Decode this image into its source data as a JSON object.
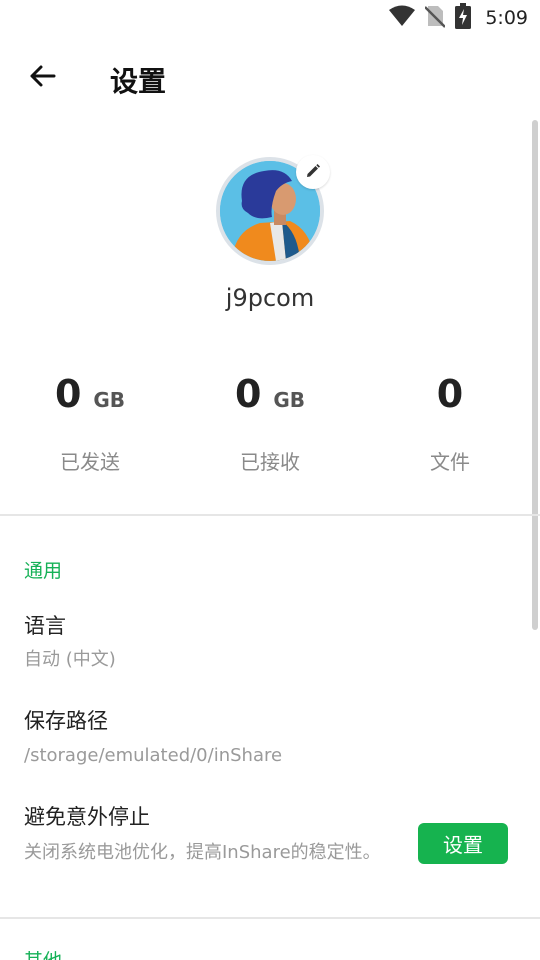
{
  "status_bar": {
    "time": "5:09",
    "icons": [
      "wifi-icon",
      "no-sim-icon",
      "battery-charging-icon"
    ]
  },
  "app_bar": {
    "back_icon": "arrow-left-icon",
    "title": "设置"
  },
  "profile": {
    "username": "j9pcom",
    "edit_icon": "pencil-icon"
  },
  "stats": [
    {
      "value": "0",
      "unit": "GB",
      "label": "已发送"
    },
    {
      "value": "0",
      "unit": "GB",
      "label": "已接收"
    },
    {
      "value": "0",
      "unit": "",
      "label": "文件"
    }
  ],
  "settings": {
    "general_header": "通用",
    "language": {
      "title": "语言",
      "value": "自动 (中文)"
    },
    "save_path": {
      "title": "保存路径",
      "value": "/storage/emulated/0/inShare"
    },
    "prevent_stop": {
      "title": "避免意外停止",
      "description": "关闭系统电池优化，提高InShare的稳定性。",
      "button_label": "设置"
    },
    "other_header": "其他"
  },
  "colors": {
    "accent": "#16b157",
    "button": "#16b34f"
  }
}
